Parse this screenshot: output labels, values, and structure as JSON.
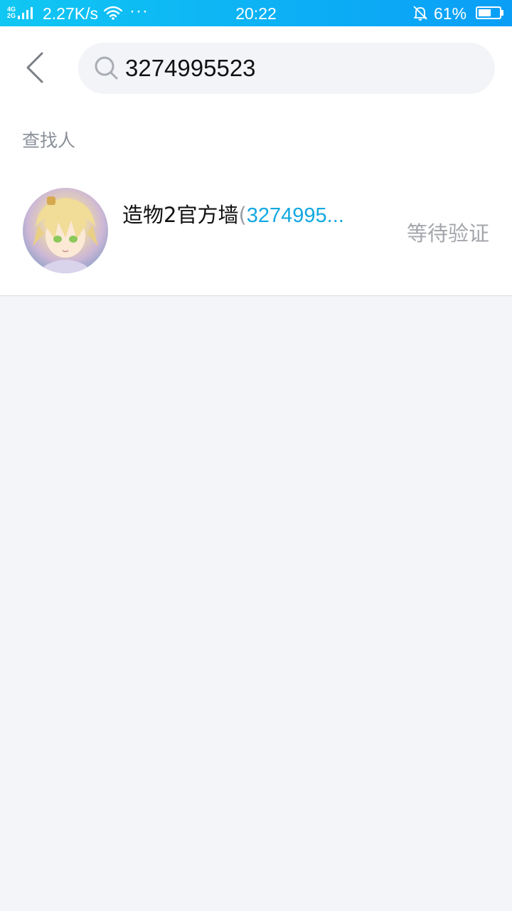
{
  "status_bar": {
    "network_top": "4G",
    "network_bottom": "2G",
    "speed": "2.27K/s",
    "more": "···",
    "time": "20:22",
    "battery": "61%",
    "battery_level": 0.61,
    "icons": [
      "signal-icon",
      "wifi-icon",
      "bell-muted-icon",
      "battery-icon"
    ]
  },
  "search": {
    "value": "3274995523",
    "icons": [
      "back-icon",
      "search-icon"
    ]
  },
  "section": {
    "title": "查找人"
  },
  "result": {
    "name": "造物2官方墙",
    "paren_open": "(",
    "qq": "3274995...",
    "status": "等待验证"
  },
  "colors": {
    "status_bar_start": "#10c7f3",
    "status_bar_end": "#0a9ef6",
    "accent_qq": "#12a8e0",
    "background": "#f3f5f9"
  }
}
